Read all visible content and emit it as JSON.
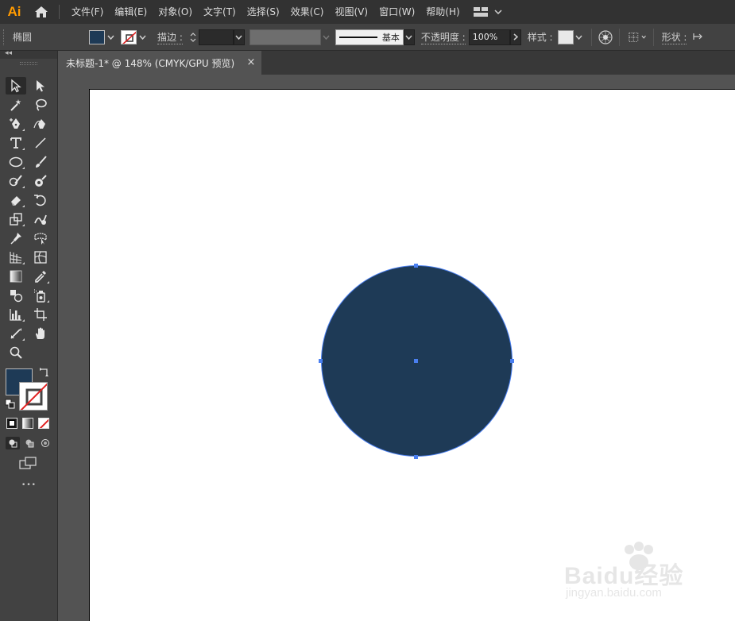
{
  "app": {
    "logo_text": "Ai"
  },
  "menu": {
    "items": [
      "文件(F)",
      "编辑(E)",
      "对象(O)",
      "文字(T)",
      "选择(S)",
      "效果(C)",
      "视图(V)",
      "窗口(W)",
      "帮助(H)"
    ]
  },
  "control_bar": {
    "object_type": "椭圆",
    "fill_color": "#1e3a56",
    "stroke_label": "描边 :",
    "stroke_profile": "基本",
    "opacity_label": "不透明度 :",
    "opacity_value": "100%",
    "style_label": "样式 :",
    "shape_label": "形状 :"
  },
  "document": {
    "tab_title": "未标题-1* @ 148% (CMYK/GPU 预览)",
    "close_glyph": "×"
  },
  "toolbox": {
    "tools": [
      "selection-tool",
      "direct-selection-tool",
      "magic-wand-tool",
      "lasso-tool",
      "pen-tool",
      "curvature-tool",
      "type-tool",
      "line-tool",
      "ellipse-tool",
      "paintbrush-tool",
      "shaper-tool",
      "blob-brush-tool",
      "eraser-tool",
      "rotate-tool",
      "scale-tool",
      "warp-tool",
      "puppet-warp-tool",
      "free-transform-tool",
      "perspective-grid-tool",
      "mesh-tool",
      "gradient-tool",
      "eyedropper-tool",
      "blend-tool",
      "symbol-sprayer-tool",
      "column-graph-tool",
      "artboard-tool",
      "slice-tool",
      "hand-tool",
      "zoom-tool"
    ],
    "fill_color": "#1e3a56",
    "more_glyph": "•••"
  },
  "canvas": {
    "circle_fill": "#1e3a56",
    "selection_color": "#4a7ff0"
  },
  "watermark": {
    "brand": "Baidu经验",
    "url": "jingyan.baidu.com"
  }
}
